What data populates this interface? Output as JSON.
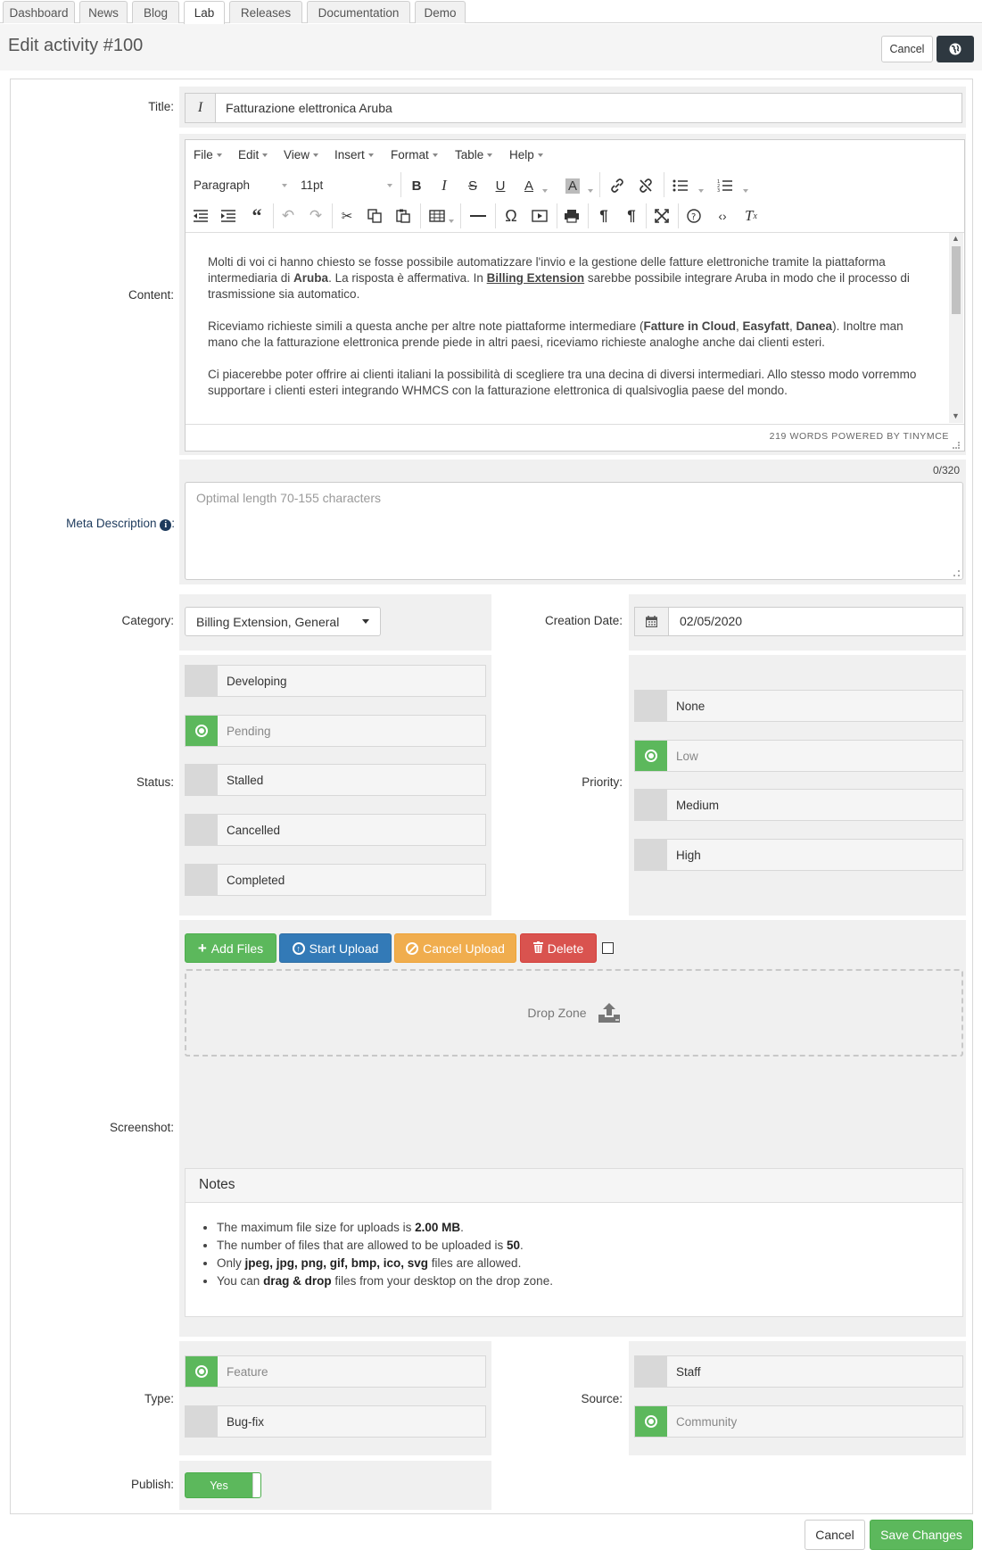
{
  "tabs": [
    "Dashboard",
    "News",
    "Blog",
    "Lab",
    "Releases",
    "Documentation",
    "Demo"
  ],
  "page_title": "Edit activity #100",
  "header": {
    "cancel": "Cancel",
    "globe_icon": "globe-icon"
  },
  "form": {
    "title_label": "Title:",
    "title_value": "Fatturazione elettronica Aruba",
    "content_label": "Content:",
    "editor": {
      "menu": [
        "File",
        "Edit",
        "View",
        "Insert",
        "Format",
        "Table",
        "Help"
      ],
      "block_format": "Paragraph",
      "font_size": "11pt",
      "para1": {
        "t1": "Molti di voi ci hanno chiesto se fosse possibile automatizzare l'invio e la gestione delle fatture elettroniche tramite la piattaforma intermediaria di ",
        "b1": "Aruba",
        "t2": ". La risposta è affermativa. In ",
        "link": "Billing Extension",
        "t3": " sarebbe possibile integrare Aruba in modo che il processo di trasmissione sia automatico."
      },
      "para2": {
        "t1": "Riceviamo richieste simili a questa anche per altre note piattaforme intermediare (",
        "b1": "Fatture in Cloud",
        "s1": ", ",
        "b2": "Easyfatt",
        "s2": ", ",
        "b3": "Danea",
        "t2": "). Inoltre man mano che la fatturazione elettronica prende piede in altri paesi, riceviamo richieste analoghe anche dai clienti esteri."
      },
      "para3": "Ci piacerebbe poter offrire ai clienti italiani la possibilità di scegliere tra una decina di diversi intermediari. Allo stesso modo vorremmo supportare i clienti esteri integrando WHMCS con la fatturazione elettronica di qualsivoglia paese del mondo.",
      "status_bar": "219 WORDS POWERED BY TINYMCE"
    },
    "meta_label": "Meta Description",
    "meta_counter": "0/320",
    "meta_placeholder": "Optimal length 70-155 characters",
    "category_label": "Category:",
    "category_value": "Billing Extension, General",
    "creation_label": "Creation Date:",
    "creation_value": "02/05/2020",
    "status_label": "Status:",
    "status_options": [
      "Developing",
      "Pending",
      "Stalled",
      "Cancelled",
      "Completed"
    ],
    "status_selected": "Pending",
    "priority_label": "Priority:",
    "priority_options": [
      "None",
      "Low",
      "Medium",
      "High"
    ],
    "priority_selected": "Low",
    "screenshot_label": "Screenshot:",
    "upload": {
      "add": "Add Files",
      "start": "Start Upload",
      "cancel": "Cancel Upload",
      "delete": "Delete",
      "drop_zone": "Drop Zone"
    },
    "notes": {
      "title": "Notes",
      "item1": {
        "t1": "The maximum file size for uploads is ",
        "b1": "2.00 MB",
        "t2": "."
      },
      "item2": {
        "t1": "The number of files that are allowed to be uploaded is ",
        "b1": "50",
        "t2": "."
      },
      "item3": {
        "t1": "Only ",
        "b1": "jpeg, jpg, png, gif, bmp, ico, svg",
        "t2": " files are allowed."
      },
      "item4": {
        "t1": "You can ",
        "b1": "drag & drop",
        "t2": " files from your desktop on the drop zone."
      }
    },
    "type_label": "Type:",
    "type_options": [
      "Feature",
      "Bug-fix"
    ],
    "type_selected": "Feature",
    "source_label": "Source:",
    "source_options": [
      "Staff",
      "Community"
    ],
    "source_selected": "Community",
    "publish_label": "Publish:",
    "publish_value": "Yes"
  },
  "footer": {
    "cancel": "Cancel",
    "save": "Save Changes"
  },
  "colors": {
    "green": "#5cb85c",
    "blue": "#337ab7",
    "orange": "#f0ad4e",
    "red": "#d9534f",
    "dark": "#2e3840"
  }
}
